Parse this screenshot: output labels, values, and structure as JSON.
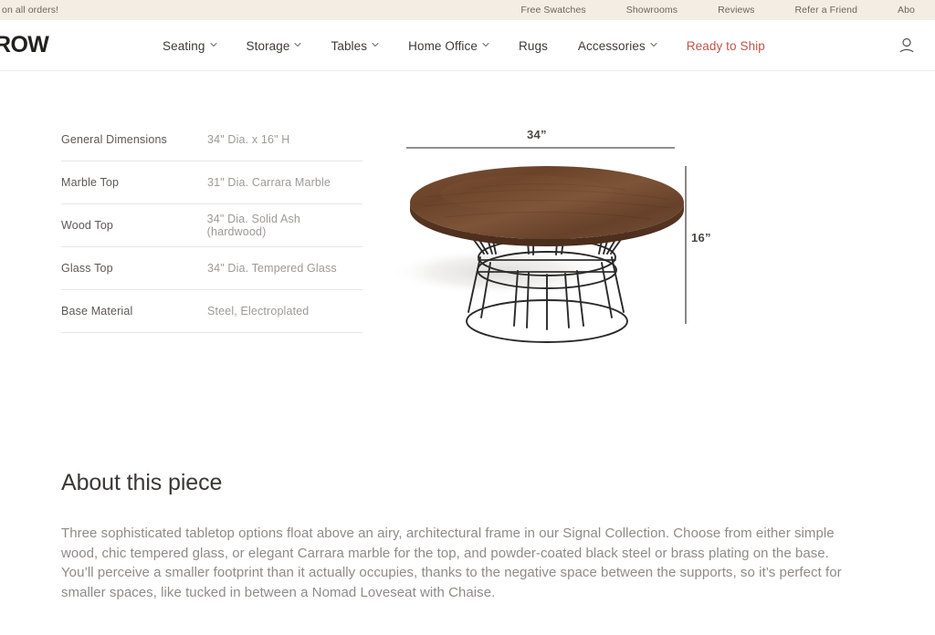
{
  "announcement": {
    "left_text": "on all orders!",
    "links": [
      {
        "label": "Free Swatches"
      },
      {
        "label": "Showrooms"
      },
      {
        "label": "Reviews"
      },
      {
        "label": "Refer a Friend"
      },
      {
        "label": "Abo"
      }
    ]
  },
  "nav": {
    "logo": "ROW",
    "items": [
      {
        "label": "Seating",
        "has_dropdown": true
      },
      {
        "label": "Storage",
        "has_dropdown": true
      },
      {
        "label": "Tables",
        "has_dropdown": true
      },
      {
        "label": "Home Office",
        "has_dropdown": true
      },
      {
        "label": "Rugs",
        "has_dropdown": false
      },
      {
        "label": "Accessories",
        "has_dropdown": true
      }
    ],
    "accent_item": {
      "label": "Ready to Ship"
    },
    "account_icon": "account-person-icon",
    "accent_color": "#c0544a"
  },
  "specs": {
    "rows": [
      {
        "label": "General Dimensions",
        "value": "34\" Dia. x 16\" H"
      },
      {
        "label": "Marble Top",
        "value": "31\" Dia. Carrara Marble"
      },
      {
        "label": "Wood Top",
        "value": "34\" Dia. Solid Ash (hardwood)"
      },
      {
        "label": "Glass Top",
        "value": "34\" Dia. Tempered Glass"
      },
      {
        "label": "Base Material",
        "value": "Steel, Electroplated"
      }
    ]
  },
  "figure": {
    "product": "round walnut coffee table with black wire base",
    "width_dimension": "34”",
    "height_dimension": "16”",
    "wood_color": "#6f472f",
    "frame_color": "#262626"
  },
  "about": {
    "title": "About this piece",
    "body": "Three sophisticated tabletop options float above an airy, architectural frame in our Signal Collection. Choose from either simple wood, chic tempered glass, or elegant Carrara marble for the top, and powder-coated black steel or brass plating on the base. You’ll perceive a smaller footprint than it actually occupies, thanks to the negative space between the supports, so it’s perfect for smaller spaces, like tucked in between a Nomad Loveseat with Chaise."
  }
}
